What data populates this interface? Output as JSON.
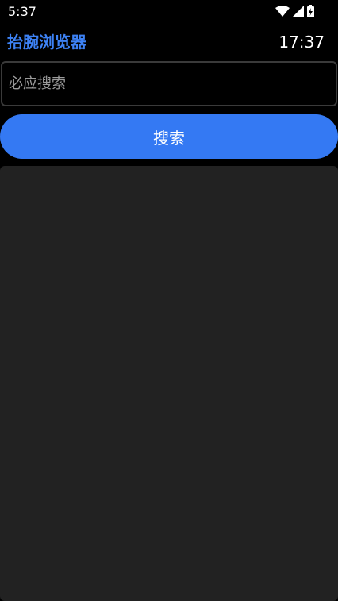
{
  "status_bar": {
    "time": "5:37",
    "icons": [
      "wifi-icon",
      "cell-signal-icon",
      "battery-icon"
    ]
  },
  "header": {
    "title": "抬腕浏览器",
    "clock": "17:37"
  },
  "search": {
    "placeholder": "必应搜索",
    "value": "",
    "button_label": "搜索"
  },
  "colors": {
    "accent": "#3479f3",
    "title": "#3d82f5",
    "background": "#000000",
    "panel": "#222222"
  }
}
